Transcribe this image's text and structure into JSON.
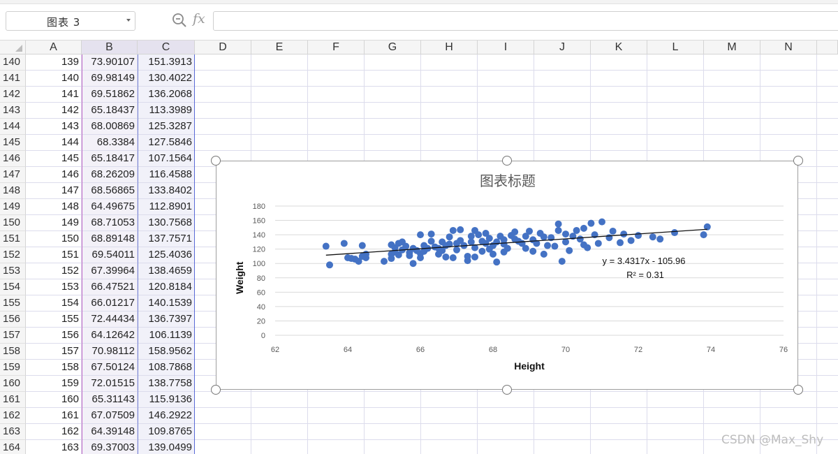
{
  "namebox": {
    "value": "图表 3"
  },
  "formula_bar": {
    "fx_label": "fx",
    "value": ""
  },
  "columns": [
    "A",
    "B",
    "C",
    "D",
    "E",
    "F",
    "G",
    "H",
    "I",
    "J",
    "K",
    "L",
    "M",
    "N"
  ],
  "rows": [
    {
      "row": "140",
      "a": "139",
      "b": "73.90107",
      "c": "151.3913"
    },
    {
      "row": "141",
      "a": "140",
      "b": "69.98149",
      "c": "130.4022"
    },
    {
      "row": "142",
      "a": "141",
      "b": "69.51862",
      "c": "136.2068"
    },
    {
      "row": "143",
      "a": "142",
      "b": "65.18437",
      "c": "113.3989"
    },
    {
      "row": "144",
      "a": "143",
      "b": "68.00869",
      "c": "125.3287"
    },
    {
      "row": "145",
      "a": "144",
      "b": "68.3384",
      "c": "127.5846"
    },
    {
      "row": "146",
      "a": "145",
      "b": "65.18417",
      "c": "107.1564"
    },
    {
      "row": "147",
      "a": "146",
      "b": "68.26209",
      "c": "116.4588"
    },
    {
      "row": "148",
      "a": "147",
      "b": "68.56865",
      "c": "133.8402"
    },
    {
      "row": "149",
      "a": "148",
      "b": "64.49675",
      "c": "112.8901"
    },
    {
      "row": "150",
      "a": "149",
      "b": "68.71053",
      "c": "130.7568"
    },
    {
      "row": "151",
      "a": "150",
      "b": "68.89148",
      "c": "137.7571"
    },
    {
      "row": "152",
      "a": "151",
      "b": "69.54011",
      "c": "125.4036"
    },
    {
      "row": "153",
      "a": "152",
      "b": "67.39964",
      "c": "138.4659"
    },
    {
      "row": "154",
      "a": "153",
      "b": "66.47521",
      "c": "120.8184"
    },
    {
      "row": "155",
      "a": "154",
      "b": "66.01217",
      "c": "140.1539"
    },
    {
      "row": "156",
      "a": "155",
      "b": "72.44434",
      "c": "136.7397"
    },
    {
      "row": "157",
      "a": "156",
      "b": "64.12642",
      "c": "106.1139"
    },
    {
      "row": "158",
      "a": "157",
      "b": "70.98112",
      "c": "158.9562"
    },
    {
      "row": "159",
      "a": "158",
      "b": "67.50124",
      "c": "108.7868"
    },
    {
      "row": "160",
      "a": "159",
      "b": "72.01515",
      "c": "138.7758"
    },
    {
      "row": "161",
      "a": "160",
      "b": "65.31143",
      "c": "115.9136"
    },
    {
      "row": "162",
      "a": "161",
      "b": "67.07509",
      "c": "146.2922"
    },
    {
      "row": "163",
      "a": "162",
      "b": "64.39148",
      "c": "109.8765"
    },
    {
      "row": "164",
      "a": "163",
      "b": "69.37003",
      "c": "139.0499"
    }
  ],
  "chart_data": {
    "type": "scatter",
    "title": "图表标题",
    "xlabel": "Height",
    "ylabel": "Weight",
    "xlim": [
      62,
      76
    ],
    "ylim": [
      0,
      180
    ],
    "xticks": [
      62,
      64,
      66,
      68,
      70,
      72,
      74,
      76
    ],
    "yticks": [
      0,
      20,
      40,
      60,
      80,
      100,
      120,
      140,
      160,
      180
    ],
    "grid": "horizontal",
    "point_color": "#4472c4",
    "trendline": {
      "slope": 3.4317,
      "intercept": -105.96,
      "x_range": [
        63.4,
        73.9
      ]
    },
    "equation_label": "y = 3.4317x - 105.96",
    "r2_label": "R² = 0.31",
    "points": [
      [
        63.4,
        124
      ],
      [
        63.5,
        98
      ],
      [
        63.9,
        128
      ],
      [
        64.0,
        108
      ],
      [
        64.1,
        107
      ],
      [
        64.2,
        106
      ],
      [
        64.3,
        103
      ],
      [
        64.4,
        110
      ],
      [
        64.4,
        125
      ],
      [
        64.5,
        113
      ],
      [
        64.5,
        108
      ],
      [
        65.0,
        103
      ],
      [
        65.2,
        113
      ],
      [
        65.2,
        107
      ],
      [
        65.2,
        126
      ],
      [
        65.3,
        116
      ],
      [
        65.3,
        122
      ],
      [
        65.4,
        128
      ],
      [
        65.4,
        112
      ],
      [
        65.5,
        119
      ],
      [
        65.5,
        130
      ],
      [
        65.6,
        124
      ],
      [
        65.7,
        115
      ],
      [
        65.7,
        111
      ],
      [
        65.8,
        100
      ],
      [
        65.8,
        121
      ],
      [
        65.9,
        118
      ],
      [
        66.0,
        140
      ],
      [
        66.0,
        114
      ],
      [
        66.0,
        108
      ],
      [
        66.1,
        125
      ],
      [
        66.1,
        117
      ],
      [
        66.2,
        121
      ],
      [
        66.3,
        131
      ],
      [
        66.3,
        141
      ],
      [
        66.4,
        123
      ],
      [
        66.5,
        121
      ],
      [
        66.5,
        113
      ],
      [
        66.6,
        130
      ],
      [
        66.6,
        118
      ],
      [
        66.7,
        125
      ],
      [
        66.7,
        109
      ],
      [
        66.8,
        127
      ],
      [
        66.8,
        137
      ],
      [
        66.9,
        108
      ],
      [
        66.9,
        146
      ],
      [
        67.0,
        128
      ],
      [
        67.0,
        119
      ],
      [
        67.1,
        147
      ],
      [
        67.1,
        132
      ],
      [
        67.2,
        125
      ],
      [
        67.3,
        110
      ],
      [
        67.3,
        104
      ],
      [
        67.4,
        138
      ],
      [
        67.4,
        130
      ],
      [
        67.5,
        109
      ],
      [
        67.5,
        122
      ],
      [
        67.5,
        146
      ],
      [
        67.6,
        140
      ],
      [
        67.7,
        117
      ],
      [
        67.7,
        131
      ],
      [
        67.8,
        128
      ],
      [
        67.8,
        142
      ],
      [
        67.9,
        120
      ],
      [
        67.9,
        135
      ],
      [
        68.0,
        125
      ],
      [
        68.0,
        113
      ],
      [
        68.1,
        102
      ],
      [
        68.1,
        130
      ],
      [
        68.2,
        138
      ],
      [
        68.3,
        116
      ],
      [
        68.3,
        127
      ],
      [
        68.3,
        133
      ],
      [
        68.4,
        121
      ],
      [
        68.5,
        139
      ],
      [
        68.6,
        134
      ],
      [
        68.6,
        144
      ],
      [
        68.7,
        131
      ],
      [
        68.8,
        128
      ],
      [
        68.9,
        138
      ],
      [
        68.9,
        121
      ],
      [
        69.0,
        145
      ],
      [
        69.1,
        117
      ],
      [
        69.1,
        133
      ],
      [
        69.2,
        128
      ],
      [
        69.3,
        142
      ],
      [
        69.4,
        137
      ],
      [
        69.4,
        113
      ],
      [
        69.5,
        125
      ],
      [
        69.6,
        136
      ],
      [
        69.7,
        124
      ],
      [
        69.8,
        146
      ],
      [
        69.8,
        155
      ],
      [
        69.9,
        103
      ],
      [
        70.0,
        130
      ],
      [
        70.0,
        141
      ],
      [
        70.1,
        118
      ],
      [
        70.2,
        138
      ],
      [
        70.3,
        146
      ],
      [
        70.4,
        134
      ],
      [
        70.5,
        126
      ],
      [
        70.5,
        149
      ],
      [
        70.6,
        122
      ],
      [
        70.7,
        156
      ],
      [
        70.8,
        140
      ],
      [
        70.9,
        128
      ],
      [
        71.0,
        158
      ],
      [
        71.2,
        136
      ],
      [
        71.3,
        145
      ],
      [
        71.5,
        129
      ],
      [
        71.6,
        141
      ],
      [
        71.8,
        132
      ],
      [
        72.0,
        139
      ],
      [
        72.4,
        137
      ],
      [
        72.6,
        134
      ],
      [
        73.0,
        143
      ],
      [
        73.9,
        151
      ],
      [
        73.8,
        140
      ]
    ]
  }
}
